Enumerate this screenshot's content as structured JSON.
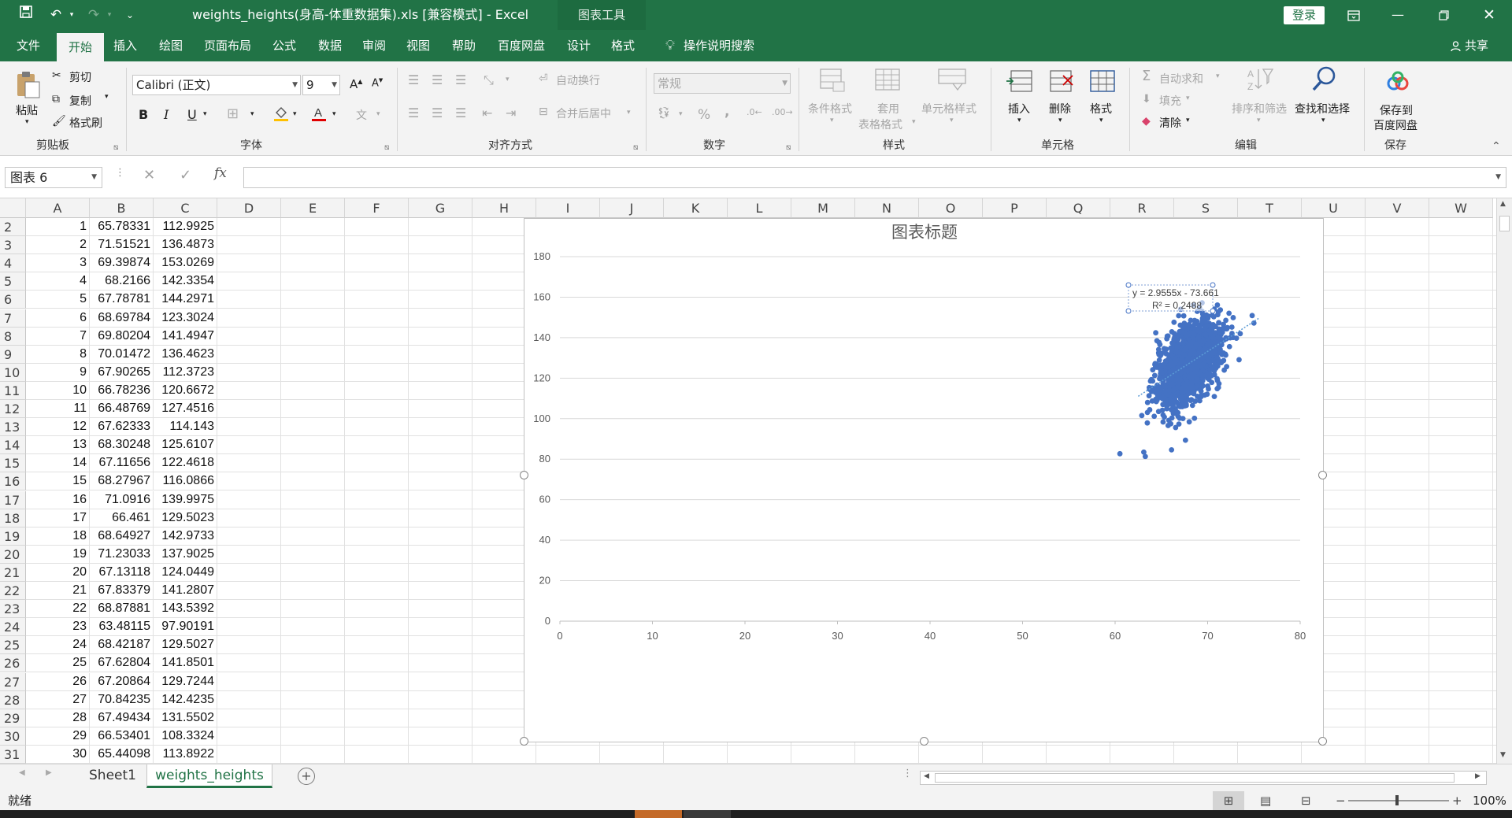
{
  "window": {
    "title": "weights_heights(身高-体重数据集).xls  [兼容模式]  -  Excel",
    "context_label": "图表工具",
    "login_label": "登录"
  },
  "tabs": [
    "文件",
    "开始",
    "插入",
    "绘图",
    "页面布局",
    "公式",
    "数据",
    "审阅",
    "视图",
    "帮助",
    "百度网盘",
    "设计",
    "格式"
  ],
  "active_tab": "开始",
  "tell_me": "操作说明搜索",
  "share": "共享",
  "ribbon": {
    "clipboard": {
      "paste": "粘贴",
      "cut": "剪切",
      "copy": "复制",
      "format_painter": "格式刷",
      "label": "剪贴板"
    },
    "font": {
      "name": "Calibri (正文)",
      "size": "9",
      "bold": "B",
      "italic": "I",
      "underline": "U",
      "grow": "A",
      "shrink": "A",
      "label": "字体"
    },
    "alignment": {
      "wrap": "自动换行",
      "merge": "合并后居中",
      "label": "对齐方式"
    },
    "number": {
      "format": "常规",
      "percent": "%",
      "comma": ",",
      "label": "数字"
    },
    "styles": {
      "cond": "条件格式",
      "table1": "套用",
      "table2": "表格格式",
      "cell": "单元格样式",
      "label": "样式"
    },
    "cells": {
      "insert": "插入",
      "delete": "删除",
      "format": "格式",
      "label": "单元格"
    },
    "editing": {
      "autosum": "自动求和",
      "fill": "填充",
      "clear": "清除",
      "sort": "排序和筛选",
      "find": "查找和选择",
      "label": "编辑"
    },
    "save": {
      "line1": "保存到",
      "line2": "百度网盘",
      "label": "保存"
    }
  },
  "formula_bar": {
    "name_box": "图表 6",
    "fx": "fx",
    "value": ""
  },
  "columns": [
    "A",
    "B",
    "C",
    "D",
    "E",
    "F",
    "G",
    "H",
    "I",
    "J",
    "K",
    "L",
    "M",
    "N",
    "O",
    "P",
    "Q",
    "R",
    "S",
    "T",
    "U",
    "V",
    "W"
  ],
  "rows": [
    {
      "r": "2",
      "a": "1",
      "b": "65.78331",
      "c": "112.9925"
    },
    {
      "r": "3",
      "a": "2",
      "b": "71.51521",
      "c": "136.4873"
    },
    {
      "r": "4",
      "a": "3",
      "b": "69.39874",
      "c": "153.0269"
    },
    {
      "r": "5",
      "a": "4",
      "b": "68.2166",
      "c": "142.3354"
    },
    {
      "r": "6",
      "a": "5",
      "b": "67.78781",
      "c": "144.2971"
    },
    {
      "r": "7",
      "a": "6",
      "b": "68.69784",
      "c": "123.3024"
    },
    {
      "r": "8",
      "a": "7",
      "b": "69.80204",
      "c": "141.4947"
    },
    {
      "r": "9",
      "a": "8",
      "b": "70.01472",
      "c": "136.4623"
    },
    {
      "r": "10",
      "a": "9",
      "b": "67.90265",
      "c": "112.3723"
    },
    {
      "r": "11",
      "a": "10",
      "b": "66.78236",
      "c": "120.6672"
    },
    {
      "r": "12",
      "a": "11",
      "b": "66.48769",
      "c": "127.4516"
    },
    {
      "r": "13",
      "a": "12",
      "b": "67.62333",
      "c": "114.143"
    },
    {
      "r": "14",
      "a": "13",
      "b": "68.30248",
      "c": "125.6107"
    },
    {
      "r": "15",
      "a": "14",
      "b": "67.11656",
      "c": "122.4618"
    },
    {
      "r": "16",
      "a": "15",
      "b": "68.27967",
      "c": "116.0866"
    },
    {
      "r": "17",
      "a": "16",
      "b": "71.0916",
      "c": "139.9975"
    },
    {
      "r": "18",
      "a": "17",
      "b": "66.461",
      "c": "129.5023"
    },
    {
      "r": "19",
      "a": "18",
      "b": "68.64927",
      "c": "142.9733"
    },
    {
      "r": "20",
      "a": "19",
      "b": "71.23033",
      "c": "137.9025"
    },
    {
      "r": "21",
      "a": "20",
      "b": "67.13118",
      "c": "124.0449"
    },
    {
      "r": "22",
      "a": "21",
      "b": "67.83379",
      "c": "141.2807"
    },
    {
      "r": "23",
      "a": "22",
      "b": "68.87881",
      "c": "143.5392"
    },
    {
      "r": "24",
      "a": "23",
      "b": "63.48115",
      "c": "97.90191"
    },
    {
      "r": "25",
      "a": "24",
      "b": "68.42187",
      "c": "129.5027"
    },
    {
      "r": "26",
      "a": "25",
      "b": "67.62804",
      "c": "141.8501"
    },
    {
      "r": "27",
      "a": "26",
      "b": "67.20864",
      "c": "129.7244"
    },
    {
      "r": "28",
      "a": "27",
      "b": "70.84235",
      "c": "142.4235"
    },
    {
      "r": "29",
      "a": "28",
      "b": "67.49434",
      "c": "131.5502"
    },
    {
      "r": "30",
      "a": "29",
      "b": "66.53401",
      "c": "108.3324"
    },
    {
      "r": "31",
      "a": "30",
      "b": "65.44098",
      "c": "113.8922"
    }
  ],
  "sheets": [
    "Sheet1",
    "weights_heights"
  ],
  "active_sheet": "weights_heights",
  "status": {
    "ready": "就绪",
    "zoom": "100%",
    "minus": "−",
    "plus": "+"
  },
  "colors": {
    "excel_green": "#217346",
    "marker": "#4472c4"
  },
  "chart_data": {
    "type": "scatter",
    "title": "图表标题",
    "xlim": [
      0,
      80
    ],
    "ylim": [
      0,
      180
    ],
    "xticks": [
      0,
      10,
      20,
      30,
      40,
      50,
      60,
      70,
      80
    ],
    "yticks": [
      0,
      20,
      40,
      60,
      80,
      100,
      120,
      140,
      160,
      180
    ],
    "grid": "horizontal",
    "series": [
      {
        "x": [
          65.78331,
          71.51521,
          69.39874,
          68.2166,
          67.78781,
          68.69784,
          69.80204,
          70.01472,
          67.90265,
          66.78236,
          66.48769,
          67.62333,
          68.30248,
          67.11656,
          68.27967,
          71.0916,
          66.461,
          68.64927,
          71.23033,
          67.13118,
          67.83379,
          68.87881,
          63.48115,
          68.42187,
          67.62804,
          67.20864,
          70.84235,
          67.49434,
          66.53401,
          65.44098,
          63.1,
          66.1,
          75.0,
          73.4,
          70.5
        ],
        "y": [
          112.9925,
          136.4873,
          153.0269,
          142.3354,
          144.2971,
          123.3024,
          141.4947,
          136.4623,
          112.3723,
          120.6672,
          127.4516,
          114.143,
          125.6107,
          122.4618,
          116.0866,
          139.9975,
          129.5023,
          142.9733,
          137.9025,
          124.0449,
          141.2807,
          143.5392,
          97.90191,
          129.5027,
          141.8501,
          129.7244,
          142.4235,
          131.5502,
          108.3324,
          113.8922,
          83.5,
          84.6,
          147.2,
          129.1,
          151.0
        ]
      }
    ],
    "trendline_equation": "y = 2.9555x - 73.661",
    "trendline_r2": "R² = 0.2488",
    "trendline": {
      "slope": 2.9555,
      "intercept": -73.661
    }
  }
}
